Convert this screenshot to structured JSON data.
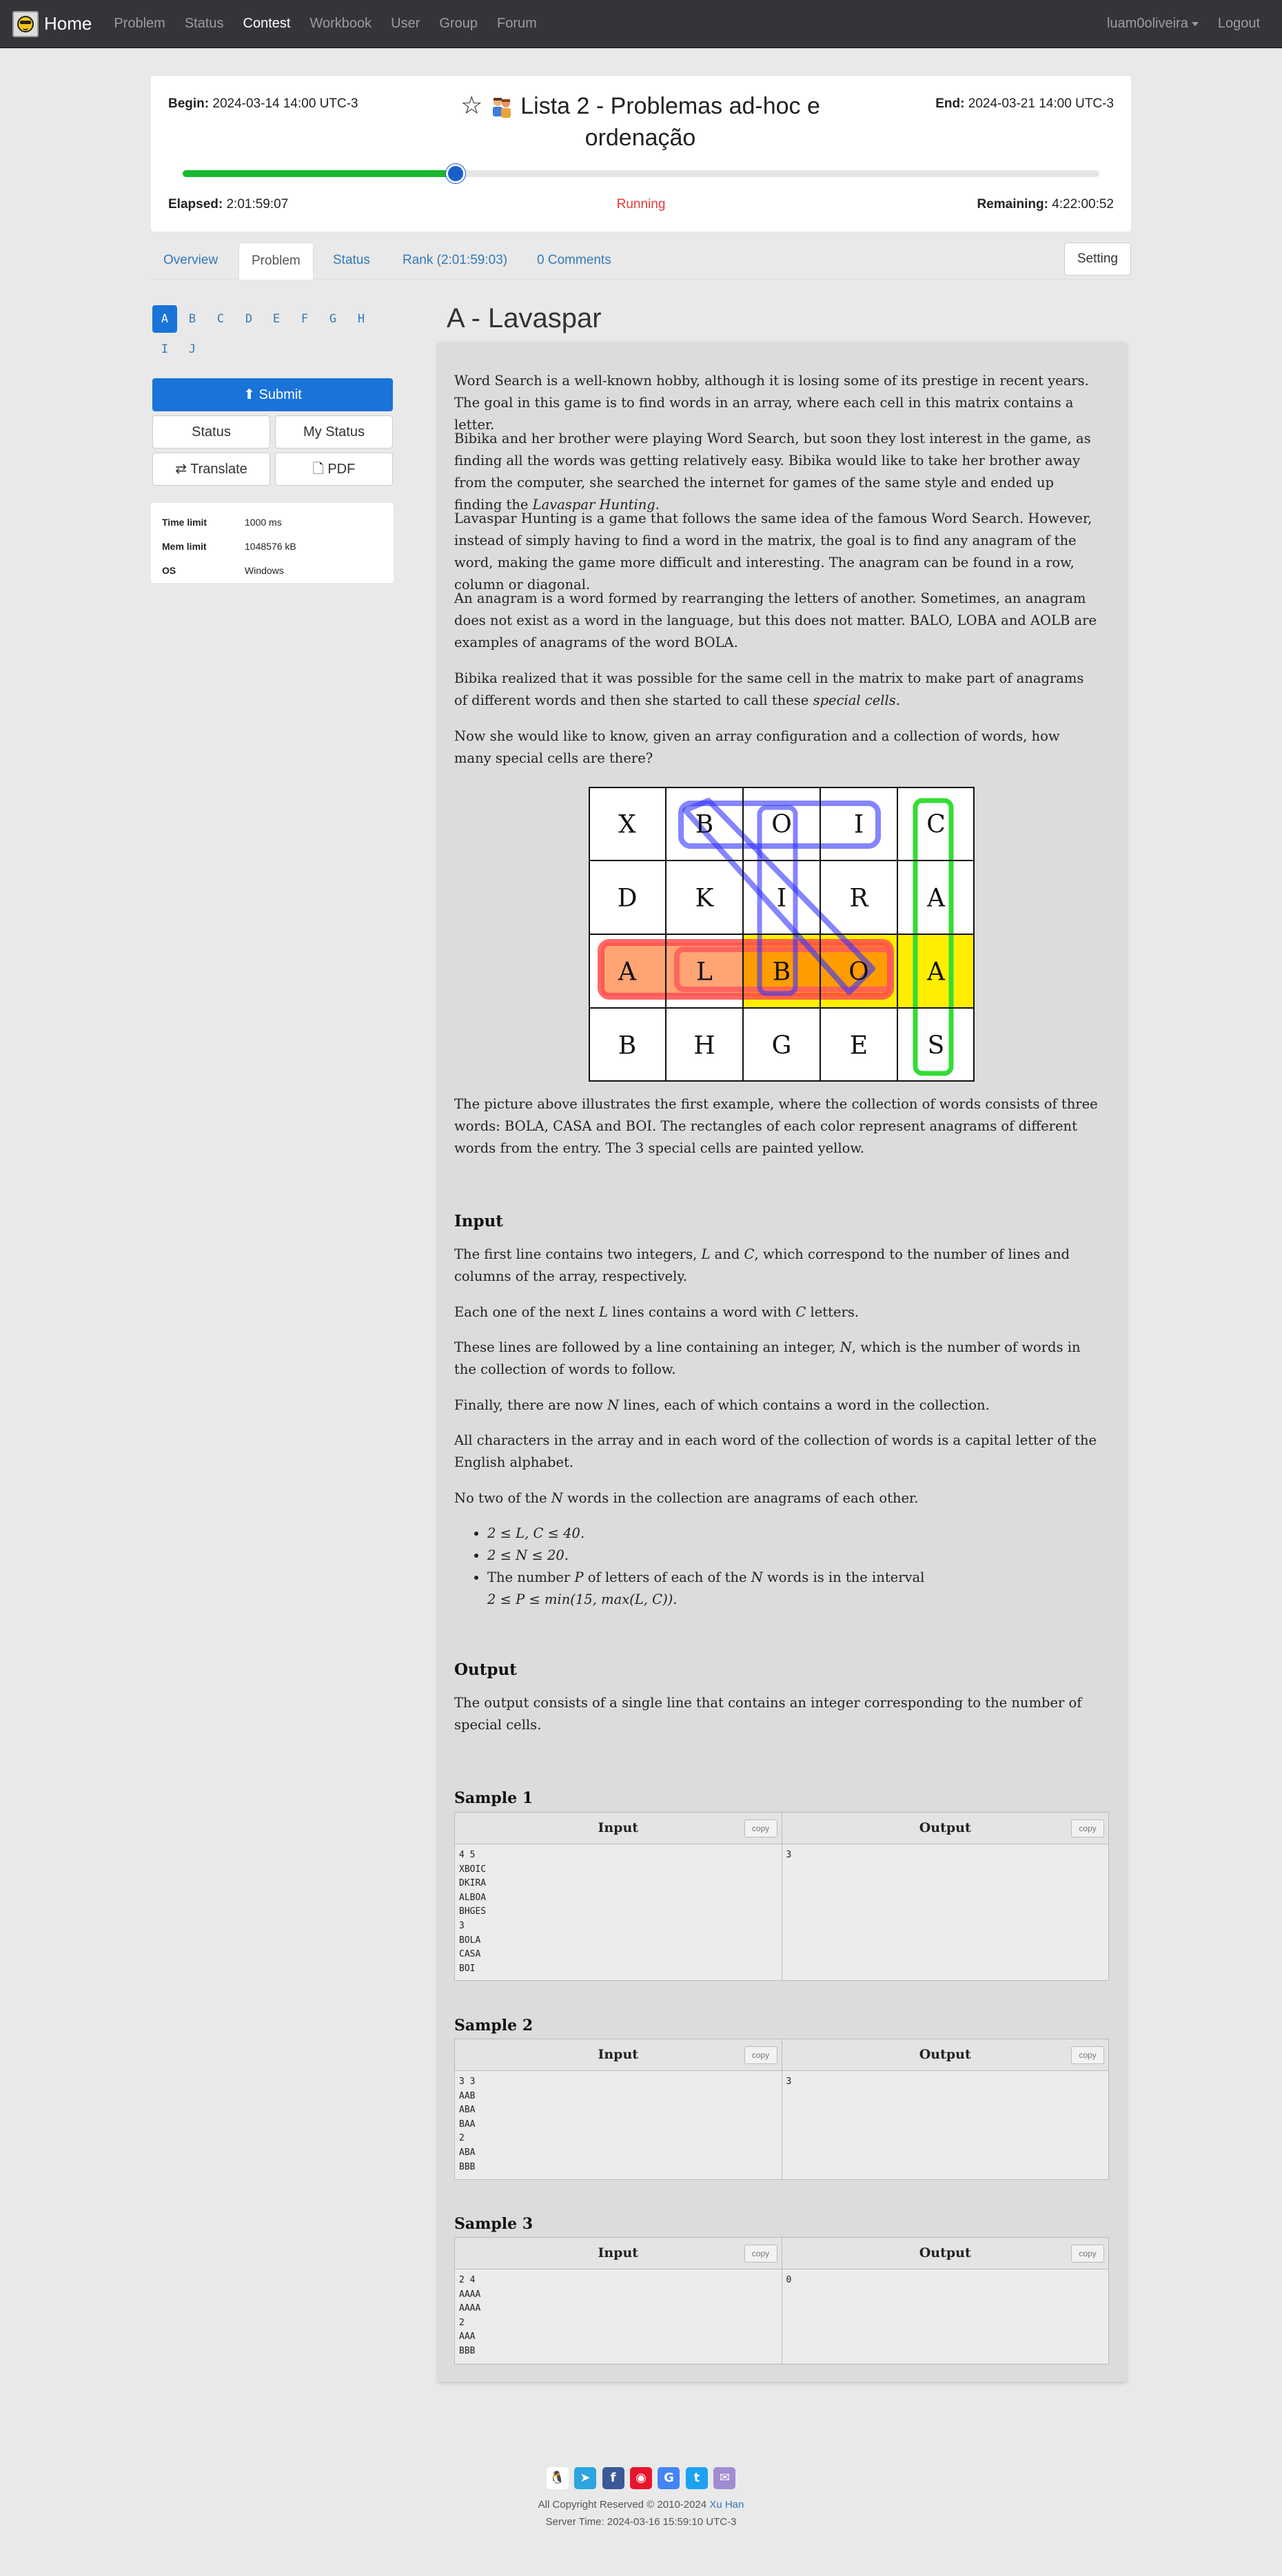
{
  "nav": {
    "brand": "Home",
    "links": [
      "Problem",
      "Status",
      "Contest",
      "Workbook",
      "User",
      "Group",
      "Forum"
    ],
    "user": "luam0oliveira",
    "logout": "Logout"
  },
  "contest": {
    "begin_label": "Begin:",
    "begin_value": "2024-03-14 14:00 UTC-3",
    "end_label": "End:",
    "end_value": "2024-03-21 14:00 UTC-3",
    "title": "Lista 2 - Problemas ad-hoc e ordenação",
    "progress_fraction": 0.298,
    "elapsed_label": "Elapsed:",
    "elapsed_value": "2:01:59:07",
    "status": "Running",
    "remaining_label": "Remaining:",
    "remaining_value": "4:22:00:52"
  },
  "tabs": {
    "overview": "Overview",
    "problem": "Problem",
    "status": "Status",
    "rank": "Rank (2:01:59:03)",
    "comments": "0 Comments",
    "setting": "Setting"
  },
  "sidebar": {
    "letters": [
      "A",
      "B",
      "C",
      "D",
      "E",
      "F",
      "G",
      "H",
      "I",
      "J"
    ],
    "submit": "Submit",
    "status": "Status",
    "my_status": "My Status",
    "translate": "Translate",
    "pdf": "PDF",
    "limits": [
      {
        "key": "Time limit",
        "value": "1000 ms"
      },
      {
        "key": "Mem limit",
        "value": "1048576 kB"
      },
      {
        "key": "OS",
        "value": "Windows"
      }
    ]
  },
  "problem": {
    "title": "A - Lavaspar",
    "p1": "Word Search is a well-known hobby, although it is losing some of its prestige in recent years. The goal in this game is to find words in an array, where each cell in this matrix contains a letter.",
    "p2a": "Bibika and her brother were playing Word Search, but soon they lost interest in the game, as finding all the words was getting relatively easy. Bibika would like to take her brother away from the computer, she searched the internet for games of the same style and ended up finding the ",
    "p2b": "Lavaspar Hunting",
    "p2c": ".",
    "p3": "Lavaspar Hunting is a game that follows the same idea of the famous Word Search. However, instead of simply having to find a word in the matrix, the goal is to find any anagram of the word, making the game more difficult and interesting. The anagram can be found in a row, column or diagonal.",
    "p4": "An anagram is a word formed by rearranging the letters of another. Sometimes, an anagram does not exist as a word in the language, but this does not matter. BALO, LOBA and AOLB are examples of anagrams of the word BOLA.",
    "p5a": "Bibika realized that it was possible for the same cell in the matrix to make part of anagrams of different words and then she started to call these ",
    "p5b": "special cells",
    "p5c": ".",
    "p6": "Now she would like to know, given an array configuration and a collection of words, how many special cells are there?",
    "grid": [
      [
        "X",
        "B",
        "O",
        "I",
        "C"
      ],
      [
        "D",
        "K",
        "I",
        "R",
        "A"
      ],
      [
        "A",
        "L",
        "B",
        "O",
        "A"
      ],
      [
        "B",
        "H",
        "G",
        "E",
        "S"
      ]
    ],
    "p7": "The picture above illustrates the first example, where the collection of words consists of three words: BOLA, CASA and BOI. The rectangles of each color represent anagrams of different words from the entry. The 3 special cells are painted yellow.",
    "input_h": "Input",
    "in1a": "The first line contains two integers, ",
    "in1b": "L",
    "in1c": " and ",
    "in1d": "C",
    "in1e": ", which correspond to the number of lines and columns of the array, respectively.",
    "in2a": "Each one of the next ",
    "in2b": "L",
    "in2c": " lines contains a word with ",
    "in2d": "C",
    "in2e": " letters.",
    "in3a": "These lines are followed by a line containing an integer, ",
    "in3b": "N",
    "in3c": ", which is the number of words in the collection of words to follow.",
    "in4a": "Finally, there are now ",
    "in4b": "N",
    "in4c": " lines, each of which contains a word in the collection.",
    "in5": "All characters in the array and in each word of the collection of words is a capital letter of the English alphabet.",
    "in6a": "No two of the ",
    "in6b": "N",
    "in6c": " words in the collection are anagrams of each other.",
    "b1": "2 ≤ L, C ≤ 40.",
    "b2": "2 ≤ N ≤ 20.",
    "b3a": "The number ",
    "b3b": "P",
    "b3c": " of letters of each of the ",
    "b3d": "N",
    "b3e": " words is in the interval",
    "b3f": "2 ≤ P ≤ min(15, max(L, C)).",
    "output_h": "Output",
    "out1": "The output consists of a single line that contains an integer corresponding to the number of special cells."
  },
  "samples": [
    {
      "title": "Sample 1",
      "input_label": "Input",
      "output_label": "Output",
      "copy": "copy",
      "input": "4 5\nXBOIC\nDKIRA\nALBOA\nBHGES\n3\nBOLA\nCASA\nBOI",
      "output": "3"
    },
    {
      "title": "Sample 2",
      "input_label": "Input",
      "output_label": "Output",
      "copy": "copy",
      "input": "3 3\nAAB\nABA\nBAA\n2\nABA\nBBB",
      "output": "3"
    },
    {
      "title": "Sample 3",
      "input_label": "Input",
      "output_label": "Output",
      "copy": "copy",
      "input": "2 4\nAAAA\nAAAA\n2\nAAA\nBBB",
      "output": "0"
    }
  ],
  "footer": {
    "copyright": "All Copyright Reserved © 2010-2024",
    "author": "Xu Han",
    "server_time": "Server Time: 2024-03-16 15:59:10 UTC-3"
  },
  "colors": {
    "accent": "#1a73d9",
    "progress": "#1ab830",
    "running": "#e53935",
    "special_cell": "#ffee00"
  }
}
